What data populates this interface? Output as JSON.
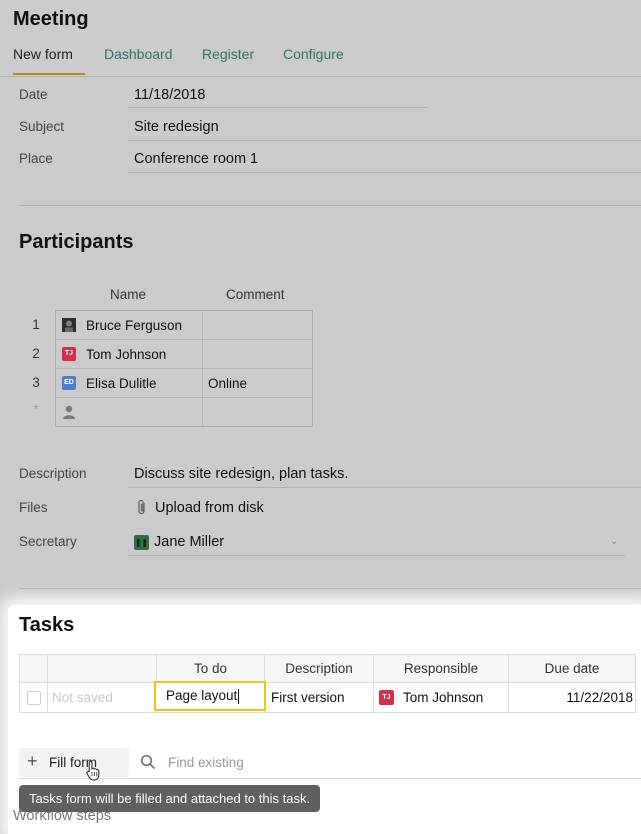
{
  "app": {
    "title": "Meeting"
  },
  "tabs": [
    {
      "label": "New form",
      "active": true
    },
    {
      "label": "Dashboard"
    },
    {
      "label": "Register"
    },
    {
      "label": "Configure"
    }
  ],
  "fields": {
    "date": {
      "label": "Date",
      "value": "11/18/2018"
    },
    "subject": {
      "label": "Subject",
      "value": "Site redesign"
    },
    "place": {
      "label": "Place",
      "value": "Conference room 1"
    }
  },
  "participants": {
    "heading": "Participants",
    "columns": [
      "Name",
      "Comment"
    ],
    "rows": [
      {
        "num": "1",
        "name": "Bruce Ferguson",
        "comment": "",
        "avatar": "photo"
      },
      {
        "num": "2",
        "name": "Tom Johnson",
        "comment": "",
        "initials": "TJ"
      },
      {
        "num": "3",
        "name": "Elisa Dulitle",
        "comment": "Online",
        "initials": "ED"
      },
      {
        "num": "*",
        "name": "",
        "comment": "",
        "avatar": "person-placeholder-icon"
      }
    ]
  },
  "description": {
    "label": "Description",
    "value": "Discuss site redesign, plan tasks."
  },
  "files": {
    "label": "Files",
    "action": "Upload from disk"
  },
  "secretary": {
    "label": "Secretary",
    "value": "Jane Miller"
  },
  "tasks": {
    "heading": "Tasks",
    "columns": [
      "To do",
      "Description",
      "Responsible",
      "Due date"
    ],
    "row": {
      "status": "Not saved",
      "todo": "Page layout",
      "description": "First version",
      "responsible": "Tom Johnson",
      "responsible_initials": "TJ",
      "due": "11/22/2018"
    },
    "fill_form_label": "Fill form",
    "find_placeholder": "Find existing",
    "tooltip": "Tasks form will be filled and attached to this task."
  },
  "workflow": {
    "label": "Workflow steps"
  },
  "colors": {
    "accent": "#b58a1a",
    "tab_link": "#2f7468",
    "focus": "#f2c21b",
    "tj_avatar": "#d2314a",
    "ed_avatar": "#4a7fc4"
  }
}
